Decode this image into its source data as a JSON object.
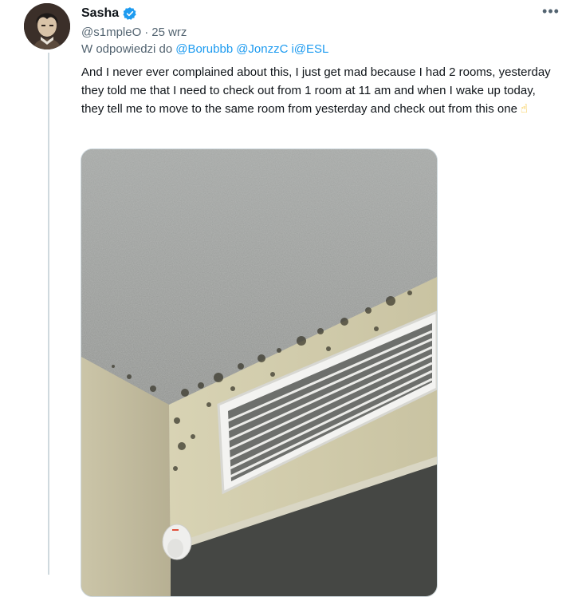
{
  "author": {
    "display_name": "Sasha",
    "handle": "@s1mpleO",
    "separator": "·",
    "date": "25 wrz",
    "verified_color": "#1d9bf0"
  },
  "more_label": "•••",
  "reply": {
    "prefix": "W odpowiedzi do",
    "mentions": [
      "@Borubbb",
      "@JonzzC",
      "i@ESL"
    ]
  },
  "tweet": {
    "text": "And I never ever complained about this, I just get mad because I had 2 rooms, yesterday they told me that I need to check out from 1 room at 11 am and when I wake up today, they tell me to move to the same room from yesterday and check out from this one",
    "emoji": "☝"
  },
  "media": {
    "icon": "ceiling-mold-photo"
  },
  "colors": {
    "link": "#1d9bf0",
    "secondary_text": "#536471",
    "border": "#cfd9de"
  }
}
